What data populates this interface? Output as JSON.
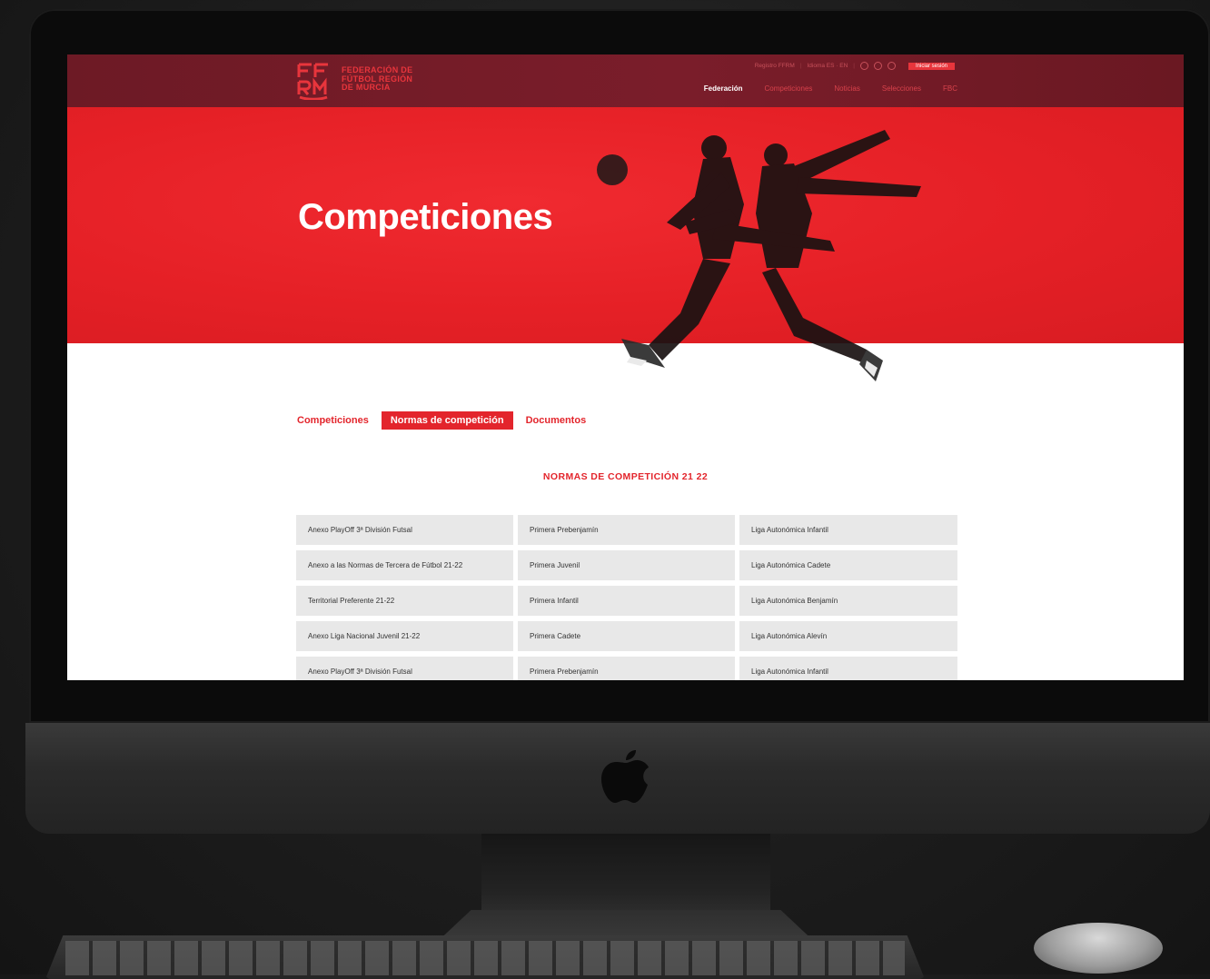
{
  "header": {
    "logo_line1": "FEDERACIÓN DE",
    "logo_line2": "FÚTBOL REGIÓN",
    "logo_line3": "DE MURCIA",
    "util_link1": "Registro FFRM",
    "util_link2": "Idioma ES · EN",
    "util_button": "Iniciar sesión",
    "nav": [
      {
        "label": "Federación"
      },
      {
        "label": "Competiciones"
      },
      {
        "label": "Noticias"
      },
      {
        "label": "Selecciones"
      },
      {
        "label": "FBC"
      }
    ]
  },
  "hero": {
    "title": "Competiciones"
  },
  "tabs": [
    {
      "label": "Competiciones"
    },
    {
      "label": "Normas de competición"
    },
    {
      "label": "Documentos"
    }
  ],
  "section_title": "NORMAS DE COMPETICIÓN 21 22",
  "documents": [
    [
      "Anexo PlayOff 3ª División Futsal",
      "Primera Prebenjamín",
      "Liga Autonómica Infantil"
    ],
    [
      "Anexo a las Normas de Tercera de Fútbol 21-22",
      "Primera Juvenil",
      "Liga Autonómica Cadete"
    ],
    [
      "Territorial Preferente 21-22",
      "Primera Infantil",
      "Liga Autonómica Benjamín"
    ],
    [
      "Anexo Liga Nacional Juvenil 21-22",
      "Primera Cadete",
      "Liga Autonómica Alevín"
    ],
    [
      "Anexo PlayOff 3ª División Futsal",
      "Primera Prebenjamín",
      "Liga Autonómica Infantil"
    ]
  ],
  "colors": {
    "brand_red": "#e3252c",
    "topbar": "#7a1d2a"
  }
}
